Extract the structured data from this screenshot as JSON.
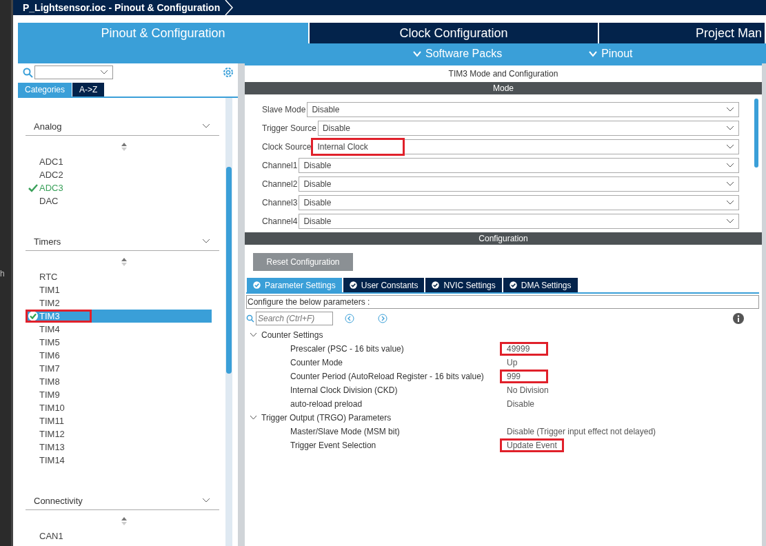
{
  "window": {
    "title": "P_Lightsensor.ioc - Pinout & Configuration"
  },
  "side_strip": {
    "text": "h"
  },
  "tabs": [
    {
      "label": "Pinout & Configuration",
      "selected": true
    },
    {
      "label": "Clock Configuration",
      "selected": false
    },
    {
      "label": "Project Man",
      "selected": false
    }
  ],
  "subbar": [
    "Software Packs",
    "Pinout"
  ],
  "sidebar": {
    "tabs": [
      {
        "label": "Categories",
        "selected": true
      },
      {
        "label": "A->Z",
        "selected": false
      }
    ],
    "groups": [
      {
        "title": "Analog",
        "items": [
          {
            "label": "ADC1",
            "configured": false,
            "selected": false,
            "highlighted": false
          },
          {
            "label": "ADC2",
            "configured": false,
            "selected": false,
            "highlighted": false
          },
          {
            "label": "ADC3",
            "configured": true,
            "selected": false,
            "highlighted": false
          },
          {
            "label": "DAC",
            "configured": false,
            "selected": false,
            "highlighted": false
          }
        ]
      },
      {
        "title": "Timers",
        "items": [
          {
            "label": "RTC",
            "configured": false,
            "selected": false,
            "highlighted": false
          },
          {
            "label": "TIM1",
            "configured": false,
            "selected": false,
            "highlighted": false
          },
          {
            "label": "TIM2",
            "configured": false,
            "selected": false,
            "highlighted": false
          },
          {
            "label": "TIM3",
            "configured": true,
            "selected": true,
            "highlighted": true
          },
          {
            "label": "TIM4",
            "configured": false,
            "selected": false,
            "highlighted": false
          },
          {
            "label": "TIM5",
            "configured": false,
            "selected": false,
            "highlighted": false
          },
          {
            "label": "TIM6",
            "configured": false,
            "selected": false,
            "highlighted": false
          },
          {
            "label": "TIM7",
            "configured": false,
            "selected": false,
            "highlighted": false
          },
          {
            "label": "TIM8",
            "configured": false,
            "selected": false,
            "highlighted": false
          },
          {
            "label": "TIM9",
            "configured": false,
            "selected": false,
            "highlighted": false
          },
          {
            "label": "TIM10",
            "configured": false,
            "selected": false,
            "highlighted": false
          },
          {
            "label": "TIM11",
            "configured": false,
            "selected": false,
            "highlighted": false
          },
          {
            "label": "TIM12",
            "configured": false,
            "selected": false,
            "highlighted": false
          },
          {
            "label": "TIM13",
            "configured": false,
            "selected": false,
            "highlighted": false
          },
          {
            "label": "TIM14",
            "configured": false,
            "selected": false,
            "highlighted": false
          }
        ]
      },
      {
        "title": "Connectivity",
        "items": [
          {
            "label": "CAN1",
            "configured": false,
            "selected": false,
            "highlighted": false
          }
        ]
      }
    ]
  },
  "panel": {
    "title": "TIM3 Mode and Configuration",
    "mode_header": "Mode",
    "mode_fields": [
      {
        "label": "Slave Mode",
        "value": "Disable",
        "highlighted": false
      },
      {
        "label": "Trigger Source",
        "value": "Disable",
        "highlighted": false
      },
      {
        "label": "Clock Source",
        "value": "Internal Clock",
        "highlighted": true
      },
      {
        "label": "Channel1",
        "value": "Disable",
        "highlighted": false
      },
      {
        "label": "Channel2",
        "value": "Disable",
        "highlighted": false
      },
      {
        "label": "Channel3",
        "value": "Disable",
        "highlighted": false
      },
      {
        "label": "Channel4",
        "value": "Disable",
        "highlighted": false
      }
    ],
    "config_header": "Configuration",
    "reset_button": "Reset Configuration",
    "config_tabs": [
      {
        "label": "Parameter Settings",
        "selected": true
      },
      {
        "label": "User Constants",
        "selected": false
      },
      {
        "label": "NVIC Settings",
        "selected": false
      },
      {
        "label": "DMA Settings",
        "selected": false
      }
    ],
    "hint": "Configure the below parameters :",
    "search": {
      "placeholder": "Search (Ctrl+F)"
    },
    "sections": [
      {
        "title": "Counter Settings",
        "expanded": true,
        "params": [
          {
            "label": "Prescaler (PSC - 16 bits value)",
            "value": "49999",
            "highlighted": true
          },
          {
            "label": "Counter Mode",
            "value": "Up",
            "highlighted": false
          },
          {
            "label": "Counter Period (AutoReload Register - 16 bits value)",
            "value": "999",
            "highlighted": true
          },
          {
            "label": "Internal Clock Division (CKD)",
            "value": "No Division",
            "highlighted": false
          },
          {
            "label": "auto-reload preload",
            "value": "Disable",
            "highlighted": false
          }
        ]
      },
      {
        "title": "Trigger Output (TRGO) Parameters",
        "expanded": true,
        "params": [
          {
            "label": "Master/Slave Mode (MSM bit)",
            "value": "Disable (Trigger input effect not delayed)",
            "highlighted": false
          },
          {
            "label": "Trigger Event Selection",
            "value": "Update Event",
            "highlighted": true
          }
        ]
      }
    ]
  }
}
